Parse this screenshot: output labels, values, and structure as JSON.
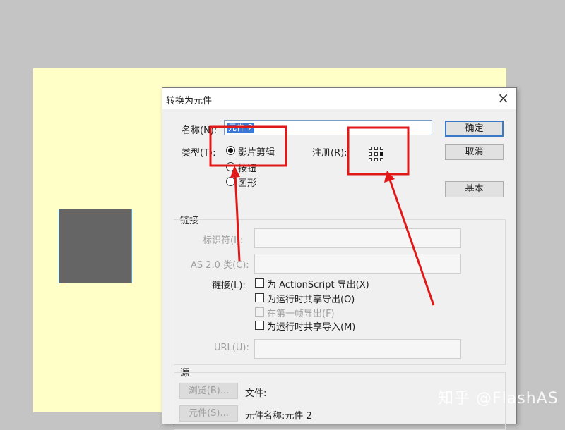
{
  "dialog": {
    "title": "转换为元件",
    "close_glyph": "×",
    "name_label": "名称(N):",
    "name_value": "元件 2",
    "type_label": "类型(T):",
    "type_options": [
      "影片剪辑",
      "按钮",
      "图形"
    ],
    "selected_type": "影片剪辑",
    "registration_label": "注册(R):",
    "buttons": {
      "ok": "确定",
      "cancel": "取消",
      "basic": "基本"
    },
    "linkage": {
      "section_label": "链接",
      "identifier_label": "标识符(I):",
      "identifier_value": "",
      "as_class_label": "AS 2.0 类(C):",
      "as_class_value": "",
      "linkage_label": "链接(L):",
      "checkboxes": [
        {
          "label": "为 ActionScript 导出(X)",
          "checked": false,
          "enabled": true
        },
        {
          "label": "为运行时共享导出(O)",
          "checked": false,
          "enabled": true
        },
        {
          "label": "在第一帧导出(F)",
          "checked": false,
          "enabled": false
        },
        {
          "label": "为运行时共享导入(M)",
          "checked": false,
          "enabled": true
        }
      ],
      "url_label": "URL(U):",
      "url_value": ""
    },
    "source": {
      "section_label": "源",
      "browse_button": "浏览(B)...",
      "file_label": "文件:",
      "symbol_button": "元件(S)...",
      "symbol_name_text": "元件名称:元件 2"
    }
  },
  "colors": {
    "annotation_red": "#e01818",
    "stage": "#ffffc7",
    "background": "#c4c4c4",
    "symbol_fill": "#656565"
  },
  "watermark": "知乎 @FlashAS"
}
